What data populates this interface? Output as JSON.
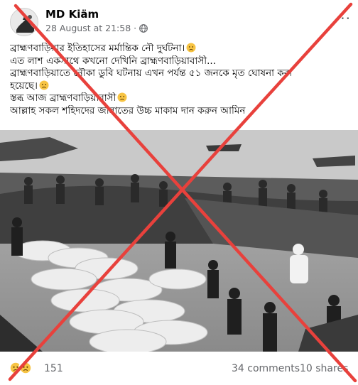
{
  "post": {
    "author": "MD Kiäm",
    "timestamp": "28 August at 21:58",
    "separator": "·",
    "privacy_icon": "globe-icon",
    "more_label": "···",
    "text_lines": [
      "ব্রাহ্মণবাড়িয়ার ইতিহাসের মর্মান্তিক নৌ দুর্ঘটনা।",
      "এত লাশ একসাথে কখনো দেখিনি ব্রাহ্মণবাড়িয়াবাসী...",
      "ব্রাহ্মণবাড়িয়াতে নৌকা ডুবি ঘটনায় এখন পর্যন্ত ৫১ জনকে মৃত ঘোষনা করা",
      "হয়েছে।",
      "স্তব্ধ আজ ব্রাহ্মণবাড়িয়াবাসী",
      "আল্লাহ সকল শহিদদের জান্নাতের উচ্চ মাকাম দান করুন আমিন"
    ]
  },
  "footer": {
    "reaction_icons": [
      "sad-reaction-icon",
      "sad-reaction-icon"
    ],
    "reaction_count": "151",
    "comments": "34 comments",
    "shares": "10 shares"
  },
  "colors": {
    "cross": "#e8413c",
    "meta_text": "#65676b",
    "sad_emoji": "#f7c444"
  }
}
